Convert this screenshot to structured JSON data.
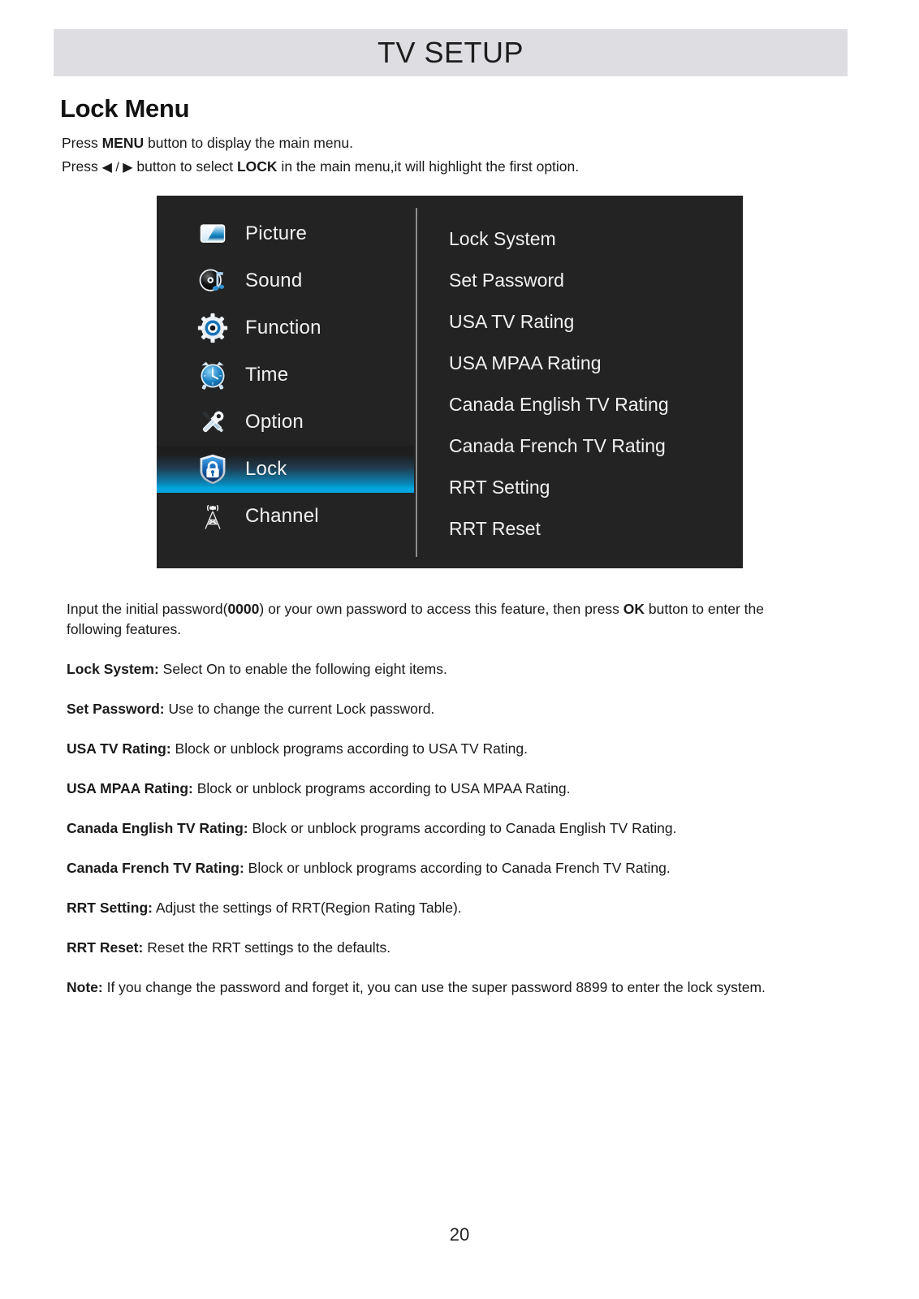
{
  "header": {
    "title": "TV SETUP"
  },
  "section": {
    "heading": "Lock Menu"
  },
  "intro": {
    "line1_pre": "Press ",
    "line1_bold": "MENU",
    "line1_post": " button to display the main menu.",
    "line2_pre": "Press ",
    "line2_arrows": "◀ / ▶",
    "line2_mid": " button to select ",
    "line2_bold": "LOCK",
    "line2_post": " in the main menu,it will highlight the first option."
  },
  "osd": {
    "selected_index": 5,
    "highlight_color": "#00a6dd",
    "panel_bg": "#232323",
    "menu": [
      {
        "label": "Picture",
        "icon": "picture-icon"
      },
      {
        "label": "Sound",
        "icon": "sound-icon"
      },
      {
        "label": "Function",
        "icon": "function-gear-icon"
      },
      {
        "label": "Time",
        "icon": "clock-icon"
      },
      {
        "label": "Option",
        "icon": "tools-icon"
      },
      {
        "label": "Lock",
        "icon": "lock-shield-icon"
      },
      {
        "label": "Channel",
        "icon": "antenna-icon"
      }
    ],
    "options": [
      {
        "label": "Lock System"
      },
      {
        "label": "Set Password"
      },
      {
        "label": "USA TV Rating"
      },
      {
        "label": "USA MPAA Rating"
      },
      {
        "label": "Canada English TV Rating"
      },
      {
        "label": "Canada French TV Rating"
      },
      {
        "label": "RRT Setting"
      },
      {
        "label": "RRT Reset"
      }
    ]
  },
  "body": {
    "intro_para": {
      "pre": "Input the initial password(",
      "bold1": "0000",
      "mid": ") or your own password to access this feature, then press ",
      "bold2": "OK",
      "post": " button to enter the following features."
    },
    "items": [
      {
        "term": "Lock System:",
        "desc": " Select On to enable the following eight items."
      },
      {
        "term": "Set Password:",
        "desc": " Use to change the current Lock password."
      },
      {
        "term": "USA TV Rating:",
        "desc": " Block or unblock programs according to USA TV Rating."
      },
      {
        "term": "USA MPAA Rating:",
        "desc": " Block or unblock programs according to USA MPAA Rating."
      },
      {
        "term": "Canada English TV Rating:",
        "desc": " Block or unblock programs according to Canada English TV Rating."
      },
      {
        "term": "Canada French TV Rating:",
        "desc": " Block or unblock programs according to Canada French TV Rating."
      },
      {
        "term": "RRT Setting:",
        "desc": " Adjust the settings of RRT(Region Rating Table)."
      },
      {
        "term": "RRT Reset:",
        "desc": " Reset the RRT settings to the defaults."
      },
      {
        "term": "Note:",
        "desc": " If you change the password and forget it, you can use the super password 8899 to enter the lock system."
      }
    ]
  },
  "footer": {
    "page_number": "20"
  }
}
